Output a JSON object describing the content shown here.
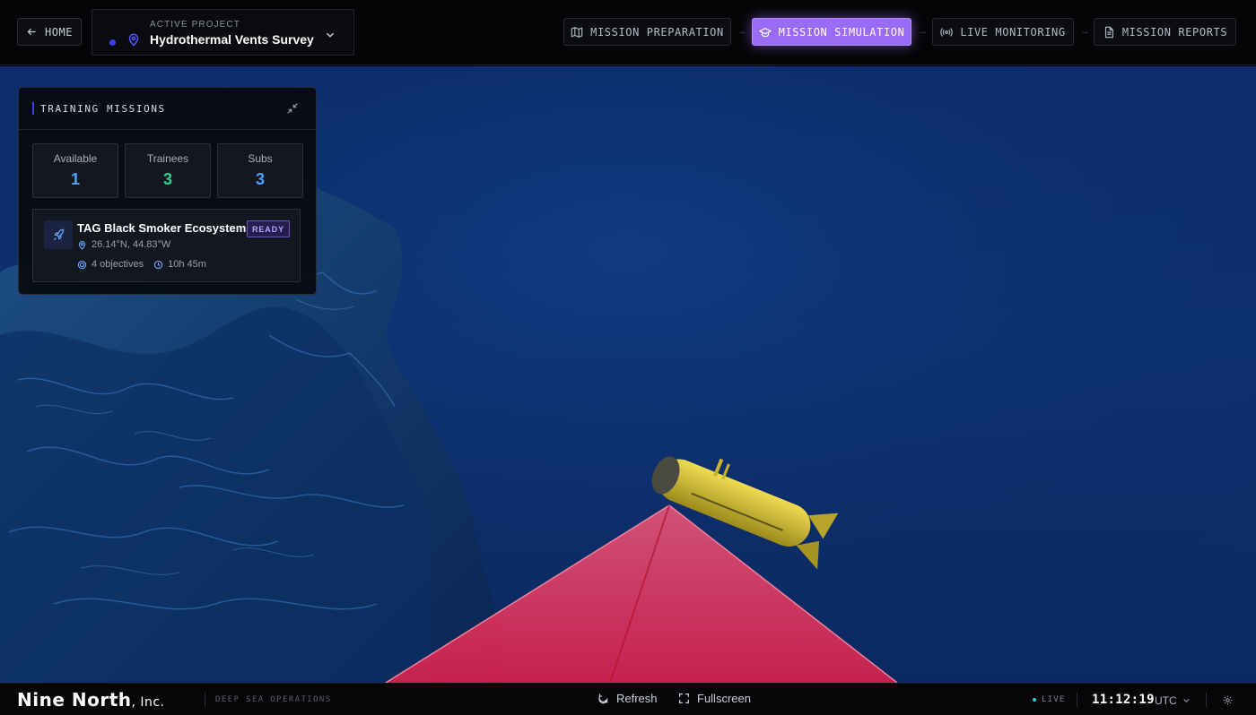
{
  "header": {
    "home_label": "HOME",
    "project_kicker": "ACTIVE PROJECT",
    "project_name": "Hydrothermal Vents Survey",
    "steps": [
      {
        "label": "MISSION PREPARATION",
        "icon": "map-icon"
      },
      {
        "label": "MISSION SIMULATION",
        "icon": "graduation-cap-icon",
        "active": true
      },
      {
        "label": "LIVE MONITORING",
        "icon": "broadcast-icon"
      },
      {
        "label": "MISSION REPORTS",
        "icon": "document-icon"
      }
    ],
    "arrow": "→"
  },
  "panel": {
    "title": "TRAINING MISSIONS",
    "stats": [
      {
        "label": "Available",
        "value": "1",
        "color": "#4aa3ff"
      },
      {
        "label": "Trainees",
        "value": "3",
        "color": "#2fd18a"
      },
      {
        "label": "Subs",
        "value": "3",
        "color": "#4aa3ff"
      }
    ],
    "mission": {
      "name": "TAG Black Smoker Ecosystem",
      "status": "READY",
      "coords": "26.14°N, 44.83°W",
      "objectives": "4 objectives",
      "duration": "10h 45m"
    }
  },
  "footer": {
    "brand": "Nine North",
    "brand_suffix": ", Inc.",
    "tagline": "DEEP SEA OPERATIONS",
    "refresh_label": "Refresh",
    "fullscreen_label": "Fullscreen",
    "live_label": "LIVE",
    "clock": "11:12:19",
    "timezone": "UTC"
  },
  "colors": {
    "accent": "#9a6cf5",
    "ocean": "#0c2c6b",
    "laser": "#ff2d55",
    "sub": "#d9c53a"
  }
}
